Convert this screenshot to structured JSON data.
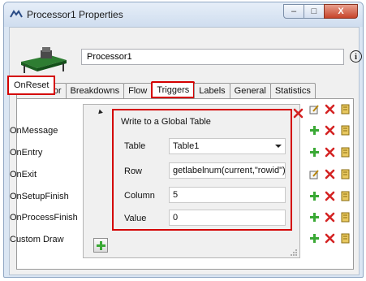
{
  "window": {
    "title": "Processor1 Properties",
    "controls": {
      "minimize": "–",
      "maximize": "□",
      "close": "X"
    }
  },
  "object_name": {
    "value": "Processor1"
  },
  "info_label": "i",
  "tabs": [
    {
      "label": "Processor"
    },
    {
      "label": "Breakdowns"
    },
    {
      "label": "Flow"
    },
    {
      "label": "Triggers",
      "active": true
    },
    {
      "label": "Labels"
    },
    {
      "label": "General"
    },
    {
      "label": "Statistics"
    }
  ],
  "triggers": [
    {
      "label": "OnReset",
      "selected": true
    },
    {
      "label": "OnMessage"
    },
    {
      "label": "OnEntry"
    },
    {
      "label": "OnExit"
    },
    {
      "label": "OnSetupFinish"
    },
    {
      "label": "OnProcessFinish"
    },
    {
      "label": "Custom Draw"
    }
  ],
  "panel": {
    "title": "Write to a Global Table",
    "fields": {
      "table": {
        "label": "Table",
        "value": "Table1"
      },
      "row": {
        "label": "Row",
        "value": "getlabelnum(current,\"rowid\")"
      },
      "column": {
        "label": "Column",
        "value": "5"
      },
      "value": {
        "label": "Value",
        "value": "0"
      }
    }
  },
  "colors": {
    "highlight": "#d40000",
    "add_green": "#3aa935",
    "delete_red": "#d42323"
  },
  "icons": [
    "processor-object-icon",
    "info-icon",
    "edit-code-icon",
    "add-icon",
    "delete-icon",
    "templates-icon",
    "expand-toggle-icon",
    "resize-grip-icon"
  ]
}
